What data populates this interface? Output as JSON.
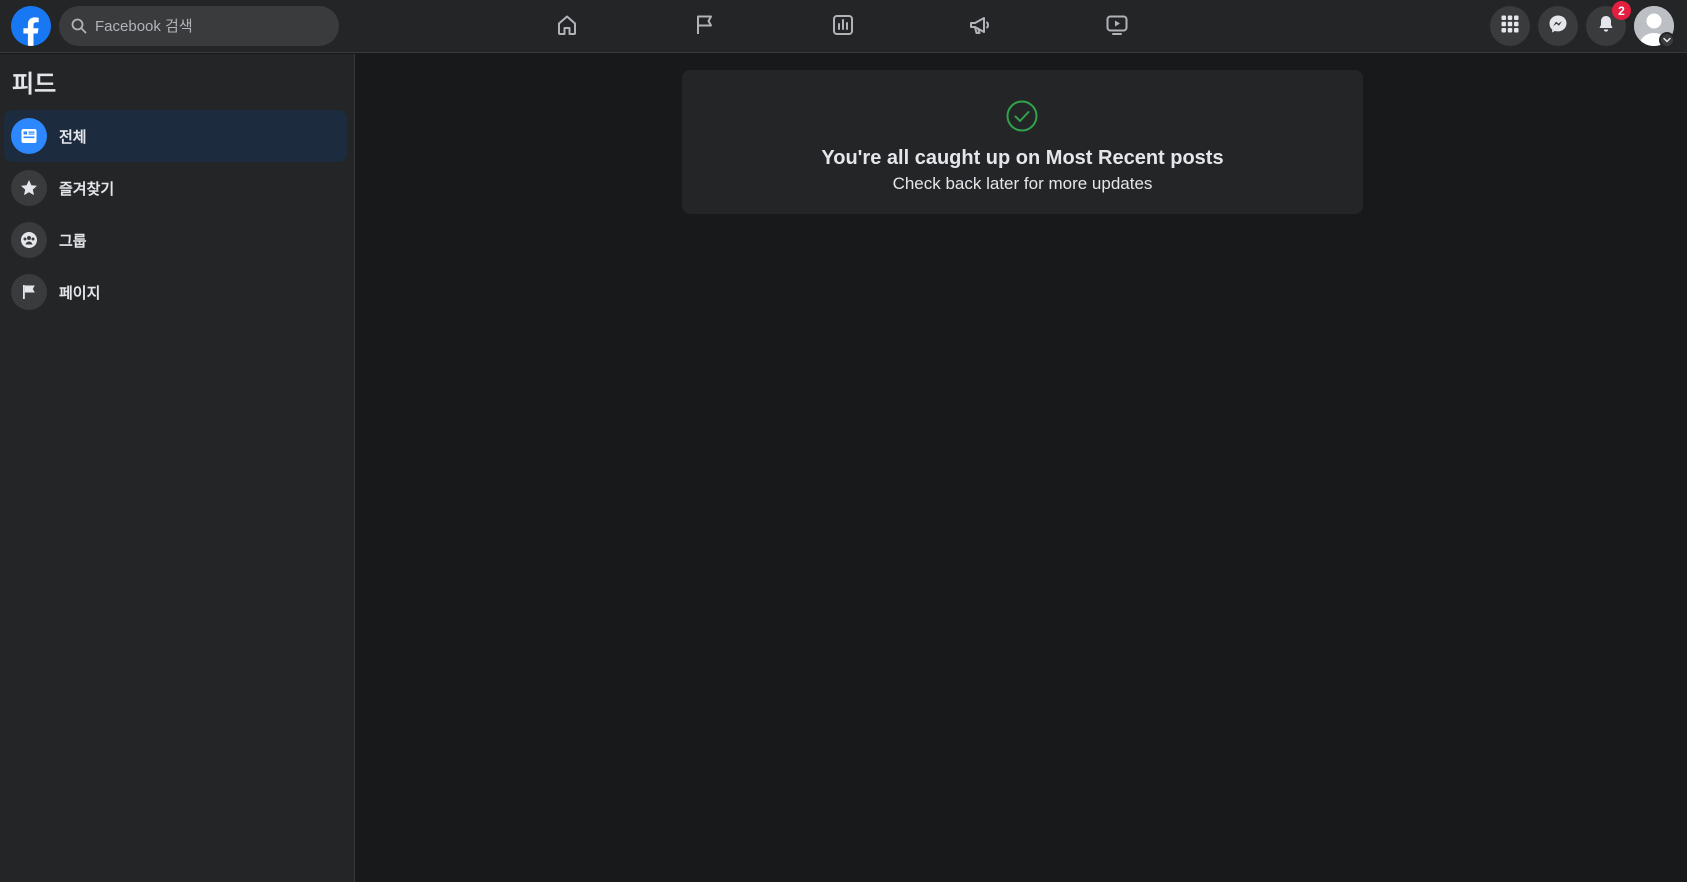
{
  "header": {
    "search_placeholder": "Facebook 검색",
    "nav_tabs": [
      {
        "name": "home",
        "icon": "home-icon"
      },
      {
        "name": "pages",
        "icon": "flag-icon"
      },
      {
        "name": "insights",
        "icon": "bar-chart-icon"
      },
      {
        "name": "ads",
        "icon": "megaphone-icon"
      },
      {
        "name": "watch",
        "icon": "video-icon"
      }
    ],
    "right_buttons": [
      {
        "name": "menu",
        "icon": "grid-menu-icon"
      },
      {
        "name": "messenger",
        "icon": "messenger-icon"
      },
      {
        "name": "notifications",
        "icon": "bell-icon",
        "badge": "2"
      }
    ]
  },
  "sidebar": {
    "title": "피드",
    "items": [
      {
        "label": "전체",
        "icon": "feed-icon",
        "active": true
      },
      {
        "label": "즐겨찾기",
        "icon": "star-icon",
        "active": false
      },
      {
        "label": "그룹",
        "icon": "group-icon",
        "active": false
      },
      {
        "label": "페이지",
        "icon": "flag-icon",
        "active": false
      }
    ]
  },
  "main": {
    "title": "You're all caught up on Most Recent posts",
    "subtitle": "Check back later for more updates"
  },
  "colors": {
    "background": "#18191a",
    "surface": "#242526",
    "accent": "#1877f2",
    "success": "#31a24c",
    "badge": "#e41e3f"
  }
}
